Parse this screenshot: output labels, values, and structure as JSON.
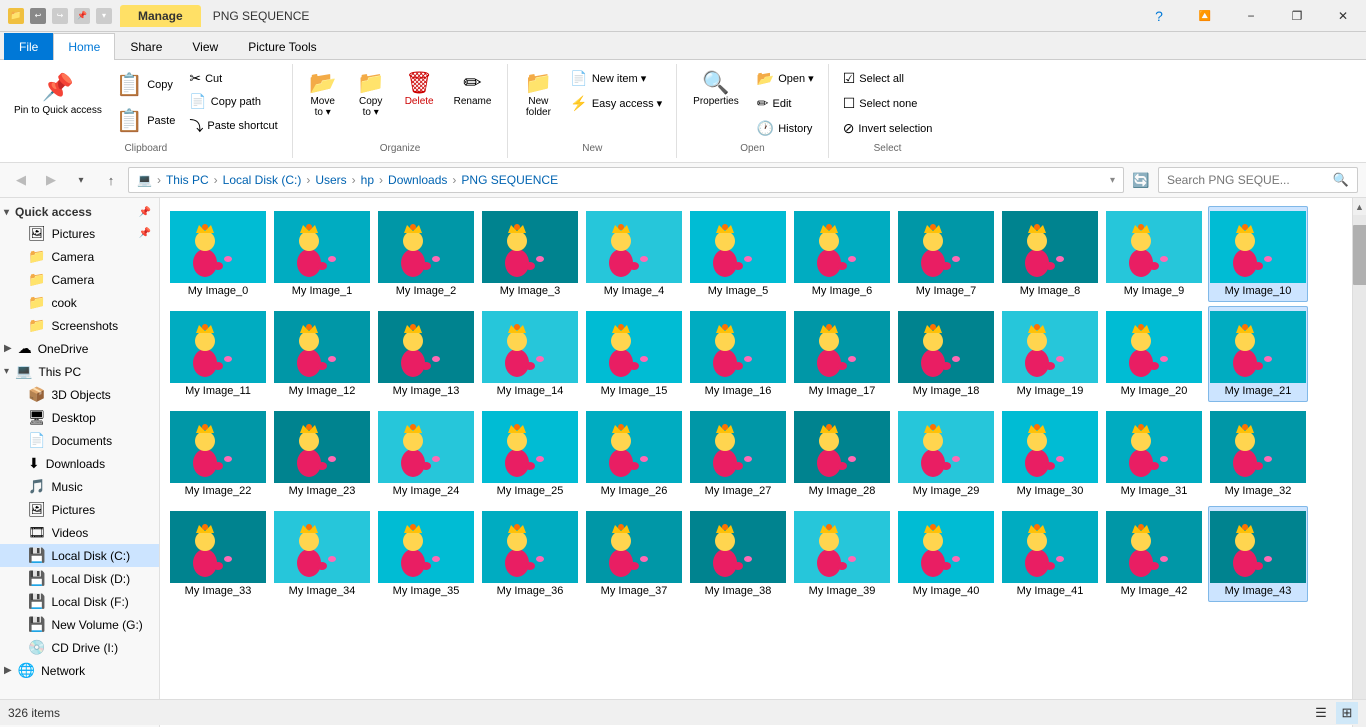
{
  "titleBar": {
    "manageTab": "Manage",
    "title": "PNG SEQUENCE",
    "minimizeLabel": "−",
    "maximizeLabel": "❐",
    "closeLabel": "✕"
  },
  "ribbon": {
    "tabs": [
      "File",
      "Home",
      "Share",
      "View",
      "Picture Tools"
    ],
    "activeTab": "Home",
    "groups": {
      "clipboard": {
        "label": "Clipboard",
        "pinLabel": "Pin to Quick\naccess",
        "copyLabel": "Copy",
        "pasteLabel": "Paste",
        "cutLabel": "Cut",
        "copyPathLabel": "Copy path",
        "pasteShortcutLabel": "Paste shortcut"
      },
      "organize": {
        "label": "Organize",
        "moveToLabel": "Move\nto",
        "copyToLabel": "Copy\nto",
        "deleteLabel": "Delete",
        "renameLabel": "Rename"
      },
      "new": {
        "label": "New",
        "newFolderLabel": "New\nfolder",
        "newItemLabel": "New item ▾",
        "easyAccessLabel": "Easy access ▾"
      },
      "open": {
        "label": "Open",
        "propertiesLabel": "Properties",
        "openLabel": "Open ▾",
        "editLabel": "Edit",
        "historyLabel": "History"
      },
      "select": {
        "label": "Select",
        "selectAllLabel": "Select all",
        "selectNoneLabel": "Select none",
        "invertSelectionLabel": "Invert selection"
      }
    }
  },
  "addressBar": {
    "path": [
      "This PC",
      "Local Disk (C:)",
      "Users",
      "hp",
      "Downloads",
      "PNG SEQUENCE"
    ],
    "searchPlaceholder": "Search PNG SEQUE..."
  },
  "sidebar": {
    "quickAccess": {
      "label": "Quick access",
      "items": [
        {
          "label": "Pictures",
          "pinned": true,
          "icon": "🖼"
        },
        {
          "label": "Camera",
          "icon": "📁"
        },
        {
          "label": "Camera",
          "icon": "📁"
        },
        {
          "label": "cook",
          "icon": "📁"
        },
        {
          "label": "Screenshots",
          "icon": "📁"
        }
      ]
    },
    "oneDrive": {
      "label": "OneDrive",
      "icon": "☁"
    },
    "thisPC": {
      "label": "This PC",
      "items": [
        {
          "label": "3D Objects",
          "icon": "📦"
        },
        {
          "label": "Desktop",
          "icon": "🖥"
        },
        {
          "label": "Documents",
          "icon": "📄"
        },
        {
          "label": "Downloads",
          "icon": "⬇"
        },
        {
          "label": "Music",
          "icon": "🎵"
        },
        {
          "label": "Pictures",
          "icon": "🖼"
        },
        {
          "label": "Videos",
          "icon": "🎞"
        },
        {
          "label": "Local Disk (C:)",
          "icon": "💾",
          "selected": true
        },
        {
          "label": "Local Disk (D:)",
          "icon": "💾"
        },
        {
          "label": "Local Disk (F:)",
          "icon": "💾"
        },
        {
          "label": "New Volume (G:)",
          "icon": "💾"
        },
        {
          "label": "CD Drive (I:)",
          "icon": "💿"
        }
      ]
    },
    "network": {
      "label": "Network",
      "icon": "🌐"
    }
  },
  "files": {
    "count": "326 items",
    "items": [
      "My Image_0",
      "My Image_1",
      "My Image_2",
      "My Image_3",
      "My Image_4",
      "My Image_5",
      "My Image_6",
      "My Image_7",
      "My Image_8",
      "My Image_9",
      "My Image_10",
      "My Image_11",
      "My Image_12",
      "My Image_13",
      "My Image_14",
      "My Image_15",
      "My Image_16",
      "My Image_17",
      "My Image_18",
      "My Image_19",
      "My Image_20",
      "My Image_21",
      "My Image_22",
      "My Image_23",
      "My Image_24",
      "My Image_25",
      "My Image_26",
      "My Image_27",
      "My Image_28",
      "My Image_29",
      "My Image_30",
      "My Image_31",
      "My Image_32",
      "My Image_33",
      "My Image_34",
      "My Image_35",
      "My Image_36",
      "My Image_37",
      "My Image_38",
      "My Image_39",
      "My Image_40",
      "My Image_41",
      "My Image_42",
      "My Image_43"
    ]
  },
  "statusBar": {
    "itemCount": "326 items"
  }
}
